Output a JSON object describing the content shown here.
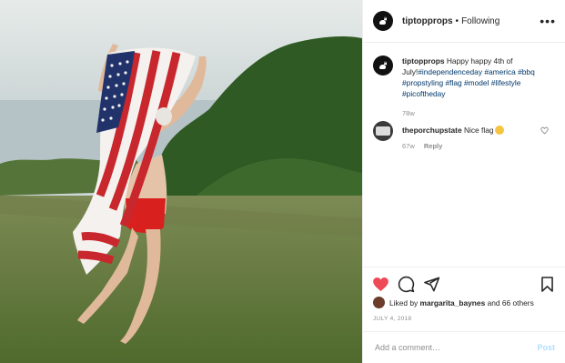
{
  "header": {
    "username": "tiptopprops",
    "separator": "•",
    "follow_status": "Following",
    "more_label": "•••"
  },
  "caption": {
    "username": "tiptopprops",
    "text": "Happy happy 4th of July!",
    "hashtags": "#independenceday #america #bbq #propstyling #flag #model #lifestyle #picoftheday",
    "time": "78w"
  },
  "comment": {
    "username": "theporchupstate",
    "text": "Nice flag",
    "time": "67w",
    "reply_label": "Reply"
  },
  "likes": {
    "prefix": "Liked by",
    "user": "margarita_baynes",
    "suffix": "and 66 others"
  },
  "date": "JULY 4, 2018",
  "add_comment": {
    "placeholder": "Add a comment…",
    "post_label": "Post"
  },
  "icons": {
    "like": "heart-filled-icon",
    "comment": "comment-icon",
    "share": "paper-plane-icon",
    "save": "bookmark-icon"
  },
  "colors": {
    "like_red": "#ed4956",
    "hashtag_blue": "#00376b",
    "muted_gray": "#8e8e8e",
    "post_disabled": "#b2dffc"
  }
}
